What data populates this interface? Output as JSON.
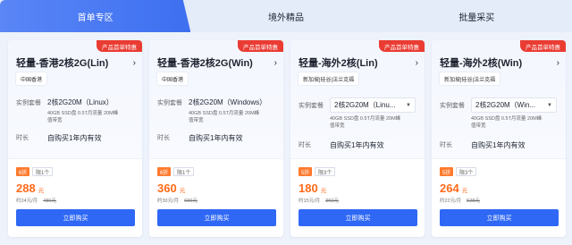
{
  "tabs": [
    "首单专区",
    "境外精品",
    "批量采买"
  ],
  "labels": {
    "package": "实例套餐",
    "duration": "时长"
  },
  "cards": [
    {
      "ribbon": "产品首单特惠",
      "title": "轻量-香港2核2G(Lin)",
      "region": "中国香港",
      "package": "2核2G20M（Linux）",
      "desc1": "40GB SSD盘 0.5T月流量 20M峰",
      "desc2": "值带宽",
      "duration": "自购买1年内有效",
      "discount": "6折",
      "limit": "限1个",
      "price": "288",
      "unit": "元",
      "monthly": "约24元/月",
      "original": "480元",
      "buy": "立即购买"
    },
    {
      "ribbon": "产品首单特惠",
      "title": "轻量-香港2核2G(Win)",
      "region": "中国香港",
      "package": "2核2G20M（Windows）",
      "desc1": "40GB SSD盘 0.5T月流量 20M峰",
      "desc2": "值带宽",
      "duration": "自购买1年内有效",
      "discount": "6折",
      "limit": "限1个",
      "price": "360",
      "unit": "元",
      "monthly": "约30元/月",
      "original": "600元",
      "buy": "立即购买"
    },
    {
      "ribbon": "产品首单特惠",
      "title": "轻量-海外2核(Lin)",
      "region": "新加坡|硅谷|法兰克福",
      "package": "2核2G20M（Linu...",
      "desc1": "40GB SSD盘 0.5T月流量 20M峰",
      "desc2": "值带宽",
      "duration": "自购买1年内有效",
      "discount": "5折",
      "limit": "限3个",
      "price": "180",
      "unit": "元",
      "monthly": "约15元/月",
      "original": "360元",
      "buy": "立即购买"
    },
    {
      "ribbon": "产品首单特惠",
      "title": "轻量-海外2核(Win)",
      "region": "新加坡|硅谷|法兰克福",
      "package": "2核2G20M（Win...",
      "desc1": "40GB SSD盘 0.5T月流量 20M峰",
      "desc2": "值带宽",
      "duration": "自购买1年内有效",
      "discount": "5折",
      "limit": "限3个",
      "price": "264",
      "unit": "元",
      "monthly": "约22元/月",
      "original": "528元",
      "buy": "立即购买"
    }
  ]
}
